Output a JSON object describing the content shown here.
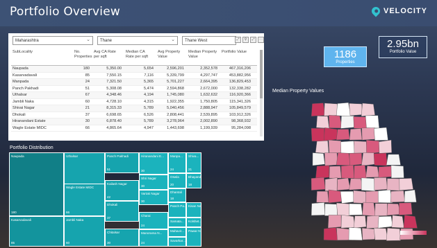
{
  "header": {
    "title": "Portfolio Overview",
    "brand": "VELOCITY"
  },
  "filters": {
    "state": "Maharashtra",
    "city": "Thane",
    "area": "Thane West"
  },
  "tools": {
    "focus": "⤢",
    "filter": "⚲",
    "expand": "⤢",
    "more": "⋯"
  },
  "table": {
    "columns": [
      "SubLocality",
      "No. Properties",
      "Avg CA Rate per sqft",
      "Median CA Rate per sqft",
      "Avg Property Value",
      "Median Property Value",
      "Portfolio Value"
    ],
    "rows": [
      [
        "Naupada",
        "180",
        "5,350.00",
        "5,654",
        "2,596,201",
        "2,352,578",
        "467,316,206"
      ],
      [
        "Kasarvadavali",
        "85",
        "7,550.15",
        "7,116",
        "5,339,799",
        "4,297,747",
        "453,882,956"
      ],
      [
        "Manpada",
        "24",
        "7,321.50",
        "5,365",
        "5,701,227",
        "2,664,395",
        "136,829,453"
      ],
      [
        "Panch Pakhadi",
        "51",
        "5,308.08",
        "5,474",
        "2,594,868",
        "2,672,000",
        "132,338,282"
      ],
      [
        "Uthalsar",
        "67",
        "4,348.46",
        "4,194",
        "1,745,080",
        "1,632,632",
        "116,920,366"
      ],
      [
        "Jambli Naka",
        "60",
        "4,728.10",
        "4,315",
        "1,922,355",
        "1,750,805",
        "115,341,326"
      ],
      [
        "Shivai Nagar",
        "21",
        "8,315.33",
        "5,789",
        "5,040,456",
        "2,888,947",
        "105,849,579"
      ],
      [
        "Dhokali",
        "37",
        "6,698.65",
        "6,526",
        "2,808,441",
        "2,539,895",
        "103,912,326"
      ],
      [
        "Hiranandani Estate",
        "30",
        "6,878.40",
        "5,789",
        "3,278,964",
        "2,002,890",
        "98,368,932"
      ],
      [
        "Wagle Estate MIDC",
        "66",
        "4,865.64",
        "4,947",
        "1,443,698",
        "1,199,939",
        "95,284,098"
      ]
    ]
  },
  "distribution": {
    "title": "Portfolio Distribution",
    "tiles": [
      {
        "label": "Naupada",
        "value": "180"
      },
      {
        "label": "Kasarvadavali",
        "value": "85"
      },
      {
        "label": "Uthalsar",
        "value": "67"
      },
      {
        "label": "Wagle Estate MIDC",
        "value": "66"
      },
      {
        "label": "Jambli Naka",
        "value": "60"
      },
      {
        "label": "Panch Pakhadi",
        "value": "51"
      },
      {
        "label": "Kailash Nagar",
        "value": "42"
      },
      {
        "label": "Dhokali",
        "value": "37"
      },
      {
        "label": "Chitalsar",
        "value": "30"
      },
      {
        "label": "Hiranandani E...",
        "value": "30"
      },
      {
        "label": "Shri Nagar",
        "value": "30"
      },
      {
        "label": "Vartak Nagar",
        "value": "30"
      },
      {
        "label": "Charai",
        "value": "24"
      },
      {
        "label": "Manorama N...",
        "value": "24"
      },
      {
        "label": "Manpa...",
        "value": "24"
      },
      {
        "label": "Shiva...",
        "value": "21"
      },
      {
        "label": "Oswla",
        "value": "20"
      },
      {
        "label": "Bhayanda...",
        "value": "18"
      },
      {
        "label": "Dhantali",
        "value": "18"
      },
      {
        "label": "Panch Pa...",
        "value": ""
      },
      {
        "label": "Kisan Na...",
        "value": ""
      },
      {
        "label": "Samata...",
        "value": ""
      },
      {
        "label": "Kolshet...",
        "value": ""
      },
      {
        "label": "Mahavir...",
        "value": ""
      },
      {
        "label": "Savarkar...",
        "value": ""
      },
      {
        "label": "Pawar N...",
        "value": ""
      }
    ]
  },
  "kpis": {
    "properties_value": "1186",
    "properties_label": "Properties",
    "portfolio_value": "2.95bn",
    "portfolio_label": "Portfolio Value"
  },
  "map": {
    "title": "Median Property Values"
  },
  "colors": {
    "accent": "#1bb3bd",
    "dark_teal": "#117f87",
    "header": "#3d5275"
  }
}
